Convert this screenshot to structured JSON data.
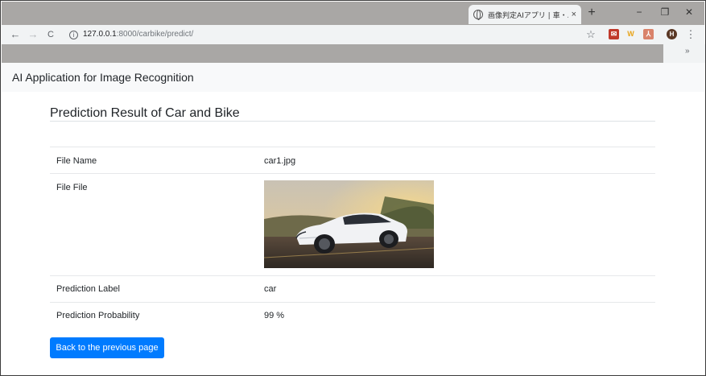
{
  "browser": {
    "tab_title": "画像判定AIアプリ | 車・バイク",
    "tab_close": "×",
    "new_tab": "+",
    "minimize": "−",
    "restore": "❐",
    "close": "✕",
    "back": "←",
    "forward": "→",
    "reload": "C",
    "info": "i",
    "url_host": "127.0.0.1",
    "url_path": ":8000/carbike/predict/",
    "star": "☆",
    "ext_w": "W",
    "avatar": "H",
    "menu": "⋮",
    "bookmarks_more": "»"
  },
  "navbar": {
    "brand": "AI Application for Image Recognition"
  },
  "result": {
    "title": "Prediction Result of Car and Bike",
    "rows": [
      {
        "label": "File Name",
        "value": "car1.jpg"
      },
      {
        "label": "File File",
        "value": ""
      },
      {
        "label": "Prediction Label",
        "value": "car"
      },
      {
        "label": "Prediction Probability",
        "value": "99 %"
      }
    ]
  },
  "actions": {
    "back_label": "Back to the previous page"
  },
  "colors": {
    "accent": "#007bff",
    "navbar_bg": "#f8f9fa",
    "chrome_frame": "#a9a7a5"
  }
}
